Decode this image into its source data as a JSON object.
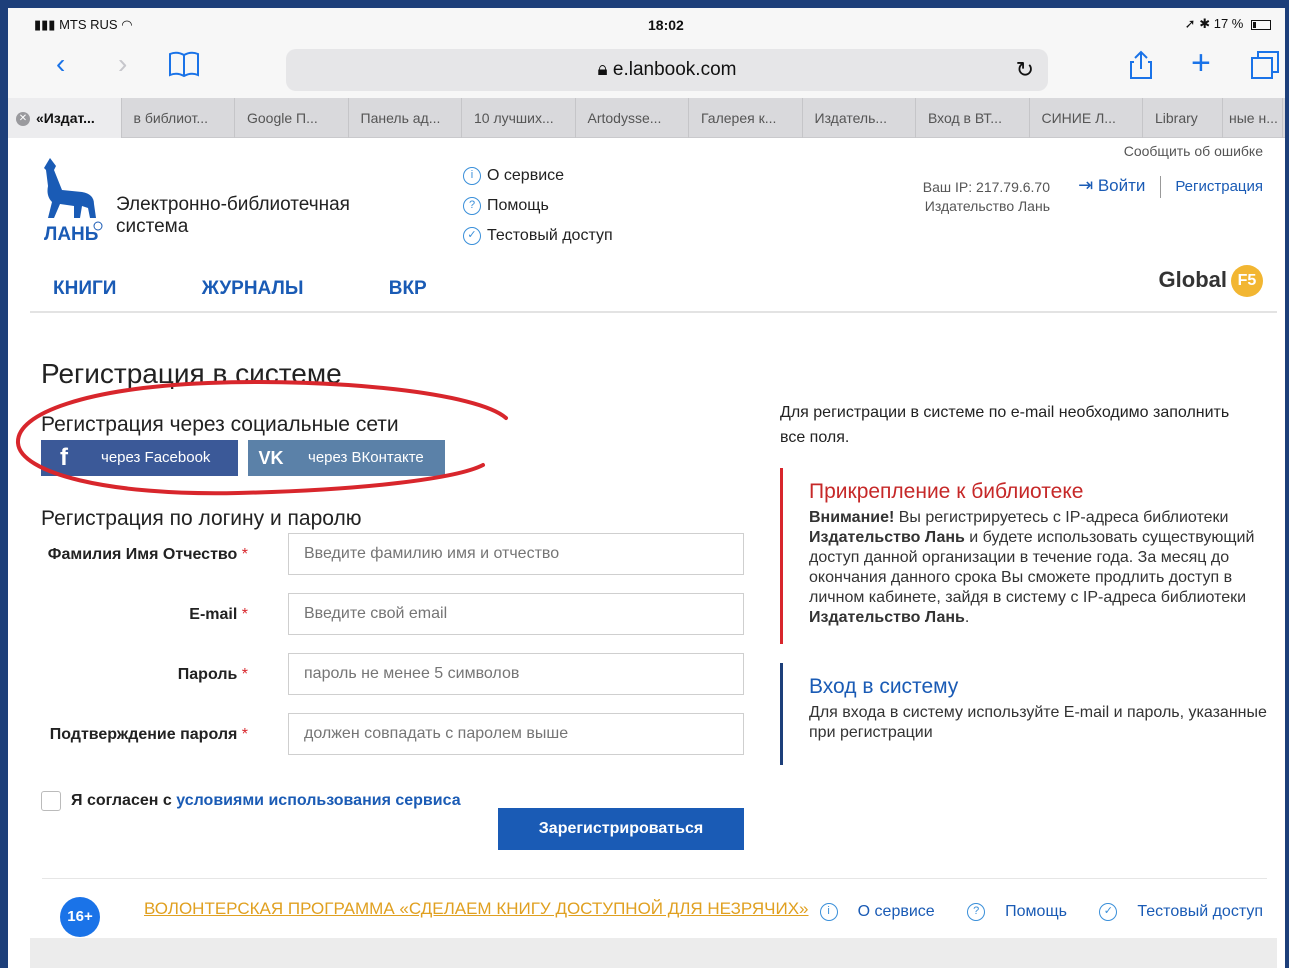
{
  "status": {
    "carrier": "MTS RUS",
    "time": "18:02",
    "battery": "17 %"
  },
  "browser": {
    "url": "e.lanbook.com",
    "tabs": [
      "«Издат...",
      "в библиот...",
      "Google П...",
      "Панель ад...",
      "10 лучших...",
      "Artodysse...",
      "Галерея к...",
      "Издатель...",
      "Вход в ВТ...",
      "СИНИЕ Л...",
      "Library",
      "ные н..."
    ]
  },
  "header": {
    "report_error": "Сообщить об ошибке",
    "logo_text": "ЛАНЬ",
    "title_line1": "Электронно-библиотечная",
    "title_line2": "система",
    "service_links": [
      "О сервисе",
      "Помощь",
      "Тестовый доступ"
    ],
    "ip_line": "Ваш IP: 217.79.6.70",
    "org_line": "Издательство Лань",
    "login": "Войти",
    "register": "Регистрация",
    "nav": [
      "КНИГИ",
      "ЖУРНАЛЫ",
      "ВКР"
    ],
    "global_brand": "Global",
    "global_badge": "F5"
  },
  "registration": {
    "title": "Регистрация в системе",
    "social_title": "Регистрация через социальные сети",
    "facebook_label": "через Facebook",
    "vk_label": "через ВКонтакте",
    "login_title": "Регистрация по логину и паролю",
    "fields": [
      {
        "label": "Фамилия Имя Отчество",
        "placeholder": "Введите фамилию имя и отчество"
      },
      {
        "label": "E-mail",
        "placeholder": "Введите свой email"
      },
      {
        "label": "Пароль",
        "placeholder": "пароль не менее 5 символов"
      },
      {
        "label": "Подтверждение пароля",
        "placeholder": "должен совпадать с паролем выше"
      }
    ],
    "required_mark": "*",
    "agree_prefix": "Я согласен с ",
    "agree_link": "условиями использования сервиса",
    "submit": "Зарегистрироваться"
  },
  "info": {
    "intro": "Для регистрации в системе по e-mail необходимо заполнить все поля.",
    "attach_title": "Прикрепление к библиотеке",
    "attach_bold1": "Внимание!",
    "attach_text1": " Вы регистрируетесь с IP-адреса библиотеки ",
    "attach_bold2": "Издательство Лань",
    "attach_text2": " и будете использовать существующий доступ данной организации в течение года. За месяц до окончания данного срока Вы сможете продлить доступ в личном кабинете, зайдя в систему с IP-адреса библиотеки ",
    "attach_bold3": "Издательство Лань",
    "attach_text3": ".",
    "login_title": "Вход в систему",
    "login_text": "Для входа в систему используйте E-mail и пароль, указанные при регистрации"
  },
  "footer": {
    "age": "16+",
    "volunteer": "ВОЛОНТЕРСКАЯ ПРОГРАММА «СДЕЛАЕМ КНИГУ ДОСТУПНОЙ ДЛЯ НЕЗРЯЧИХ»",
    "links": [
      "О сервисе",
      "Помощь",
      "Тестовый доступ"
    ]
  }
}
